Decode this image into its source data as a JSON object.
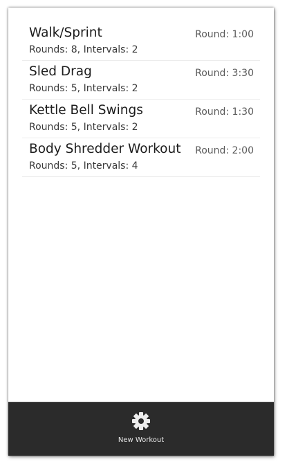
{
  "workouts": [
    {
      "name": "Walk/Sprint",
      "details": "Rounds: 8, Intervals: 2",
      "round": "Round: 1:00"
    },
    {
      "name": "Sled Drag",
      "details": "Rounds: 5, Intervals: 2",
      "round": "Round: 3:30"
    },
    {
      "name": "Kettle Bell Swings",
      "details": "Rounds: 5, Intervals: 2",
      "round": "Round: 1:30"
    },
    {
      "name": "Body Shredder Workout",
      "details": "Rounds: 5, Intervals: 4",
      "round": "Round: 2:00"
    }
  ],
  "action_bar": {
    "new_workout_label": "New Workout",
    "new_workout_icon": "gear-icon"
  },
  "colors": {
    "action_bar_bg": "#2b2b2b",
    "text_primary": "#1c1c1c",
    "divider": "#ececec"
  }
}
